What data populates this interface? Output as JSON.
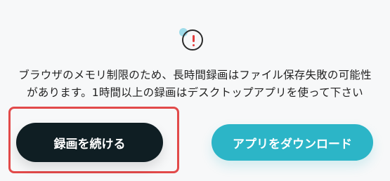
{
  "dialog": {
    "icon": "alert-circle-icon",
    "message_lines": [
      "ブラウザのメモリ制限のため、長時間録画はファイル保存失敗の可能性",
      "があります。1時間以上の録画はデスクトップアプリを使って下さい"
    ],
    "buttons": {
      "continue_recording": "録画を続ける",
      "download_app": "アプリをダウンロード"
    }
  },
  "colors": {
    "background": "#f7f8f9",
    "primary_button": "#0f1e23",
    "secondary_button": "#2cb5c7",
    "highlight": "#e24a4a",
    "alert": "#e23b3b"
  }
}
